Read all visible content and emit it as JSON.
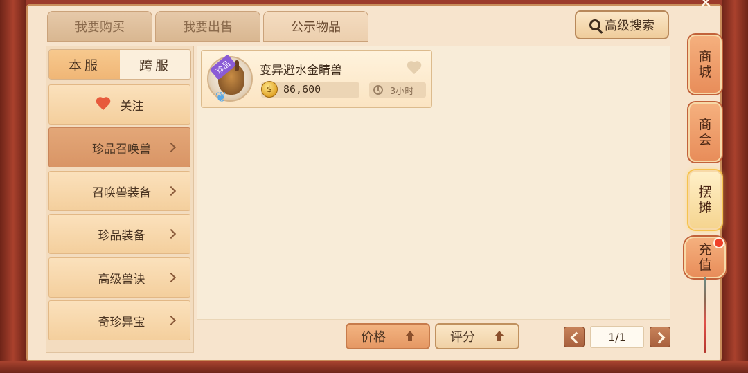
{
  "tabs": [
    {
      "label": "我要购买"
    },
    {
      "label": "我要出售"
    },
    {
      "label": "公示物品"
    }
  ],
  "search": {
    "label": "高级搜索",
    "icon": "search-icon"
  },
  "server_toggle": {
    "local": "本服",
    "cross": "跨服",
    "selected": "本服"
  },
  "categories": [
    {
      "label": "关注"
    },
    {
      "label": "珍品召唤兽"
    },
    {
      "label": "召唤兽装备"
    },
    {
      "label": "珍品装备"
    },
    {
      "label": "高级兽诀"
    },
    {
      "label": "奇珍异宝"
    }
  ],
  "selected_category": "珍品召唤兽",
  "items": [
    {
      "name": "变异避水金睛兽",
      "badge": "珍品",
      "price": "86,600",
      "time": "3小时",
      "favorited": false
    }
  ],
  "sort": {
    "price_label": "价格",
    "rating_label": "评分"
  },
  "pager": {
    "value": "1/1"
  },
  "side_nav": [
    {
      "label": "商城"
    },
    {
      "label": "商会"
    },
    {
      "label": "摆摊"
    },
    {
      "label": "充值"
    }
  ],
  "colors": {
    "accent": "#e59864",
    "frame": "#9c3b2b",
    "panel": "#f8ecd8"
  }
}
